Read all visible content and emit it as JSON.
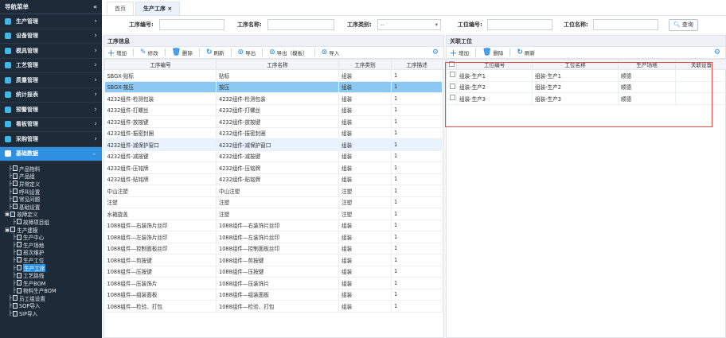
{
  "sidebar": {
    "title": "导航菜单",
    "collapse": "«",
    "menus": [
      {
        "label": "生产管理",
        "color": "#3fb8e8"
      },
      {
        "label": "设备管理",
        "color": "#3fb8e8"
      },
      {
        "label": "模具管理",
        "color": "#3fb8e8"
      },
      {
        "label": "工艺管理",
        "color": "#3fb8e8"
      },
      {
        "label": "质量管理",
        "color": "#3fb8e8"
      },
      {
        "label": "统计报表",
        "color": "#3fb8e8"
      },
      {
        "label": "预警管理",
        "color": "#3fb8e8"
      },
      {
        "label": "看板管理",
        "color": "#3fb8e8"
      },
      {
        "label": "采购管理",
        "color": "#3fb8e8"
      },
      {
        "label": "基础数据",
        "color": "#ffffff"
      }
    ],
    "tree": [
      {
        "label": "产品物料",
        "indent": 1
      },
      {
        "label": "产品组",
        "indent": 1
      },
      {
        "label": "异常定义",
        "indent": 1
      },
      {
        "label": "呼叫设置",
        "indent": 1
      },
      {
        "label": "常见问题",
        "indent": 1
      },
      {
        "label": "基础设置",
        "indent": 1
      },
      {
        "label": "故障定义",
        "indent": 0
      },
      {
        "label": "故障项目组",
        "indent": 2
      },
      {
        "label": "生产建模",
        "indent": 0
      },
      {
        "label": "生产中心",
        "indent": 2
      },
      {
        "label": "生产场地",
        "indent": 2
      },
      {
        "label": "班次维护",
        "indent": 2
      },
      {
        "label": "生产工位",
        "indent": 2
      },
      {
        "label": "生产工序",
        "indent": 2
      },
      {
        "label": "工艺路线",
        "indent": 2
      },
      {
        "label": "生产BOM",
        "indent": 2
      },
      {
        "label": "物料生产BOM",
        "indent": 2
      },
      {
        "label": "员工组设置",
        "indent": 1
      },
      {
        "label": "SOP导入",
        "indent": 1
      },
      {
        "label": "SIP导入",
        "indent": 1
      }
    ]
  },
  "tabs": [
    {
      "label": "首页"
    },
    {
      "label": "生产工序 ×"
    }
  ],
  "search": {
    "proc_code_label": "工序编号:",
    "proc_name_label": "工序名称:",
    "proc_type_label": "工序类别:",
    "proc_type_value": "--",
    "station_code_label": "工位编号:",
    "station_name_label": "工位名称:",
    "query": "查询"
  },
  "left": {
    "title": "工序信息",
    "toolbar": [
      "增加",
      "修改",
      "删除",
      "刷新",
      "导出",
      "导出（模板）",
      "导入"
    ],
    "headers": [
      "工序编号",
      "工序名称",
      "工序类别",
      "工序描述"
    ],
    "rows": [
      [
        "SBGX-贴标",
        "贴标",
        "组装",
        "1"
      ],
      [
        "SBGX-按压",
        "按压",
        "组装",
        "1"
      ],
      [
        "4232组件-检测包装",
        "4232组件-检测包装",
        "组装",
        "1"
      ],
      [
        "4232组件-打螺丝",
        "4232组件-打螺丝",
        "组装",
        "1"
      ],
      [
        "4232组件-放按键",
        "4232组件-放按键",
        "组装",
        "1"
      ],
      [
        "4232组件-振密封圈",
        "4232组件-振密封圈",
        "组装",
        "1"
      ],
      [
        "4232组件-减保护窗口",
        "4232组件-减保护窗口",
        "组装",
        "1"
      ],
      [
        "4232组件-减按键",
        "4232组件-减按键",
        "组装",
        "1"
      ],
      [
        "4232组件-压铭牌",
        "4232组件-压铭牌",
        "组装",
        "1"
      ],
      [
        "4232组件-贴铭牌",
        "4232组件-贴铭牌",
        "组装",
        "1"
      ],
      [
        "中山注塑",
        "中山注塑",
        "注塑",
        "1"
      ],
      [
        "注塑",
        "注塑",
        "注塑",
        "1"
      ],
      [
        "水箱旋盖",
        "注塑",
        "注塑",
        "1"
      ],
      [
        "1088组件—右装饰片丝印",
        "1088组件—右装饰片丝印",
        "组装",
        "1"
      ],
      [
        "1088组件—左装饰片丝印",
        "1088组件—左装饰片丝印",
        "组装",
        "1"
      ],
      [
        "1088组件—控制面板丝印",
        "1088组件—控制面板丝印",
        "组装",
        "1"
      ],
      [
        "1088组件—剪按键",
        "1088组件—剪按键",
        "组装",
        "1"
      ],
      [
        "1088组件—压按键",
        "1088组件—压按键",
        "组装",
        "1"
      ],
      [
        "1088组件—压装饰片",
        "1088组件—压装饰片",
        "组装",
        "1"
      ],
      [
        "1088组件—组装面板",
        "1088组件—组装面板",
        "组装",
        "1"
      ],
      [
        "1088组件—检验、打包",
        "1088组件—检验、打包",
        "组装",
        "1"
      ]
    ]
  },
  "right": {
    "title": "关联工位",
    "toolbar": [
      "增加",
      "删除",
      "刷新"
    ],
    "headers": [
      "",
      "工位编号",
      "工位名称",
      "生产场地",
      "关联设备"
    ],
    "rows": [
      [
        "",
        "组装-生产1",
        "组装-生产1",
        "顺德"
      ],
      [
        "",
        "组装-生产2",
        "组装-生产2",
        "顺德"
      ],
      [
        "",
        "组装-生产3",
        "组装-生产3",
        "顺德"
      ]
    ]
  }
}
